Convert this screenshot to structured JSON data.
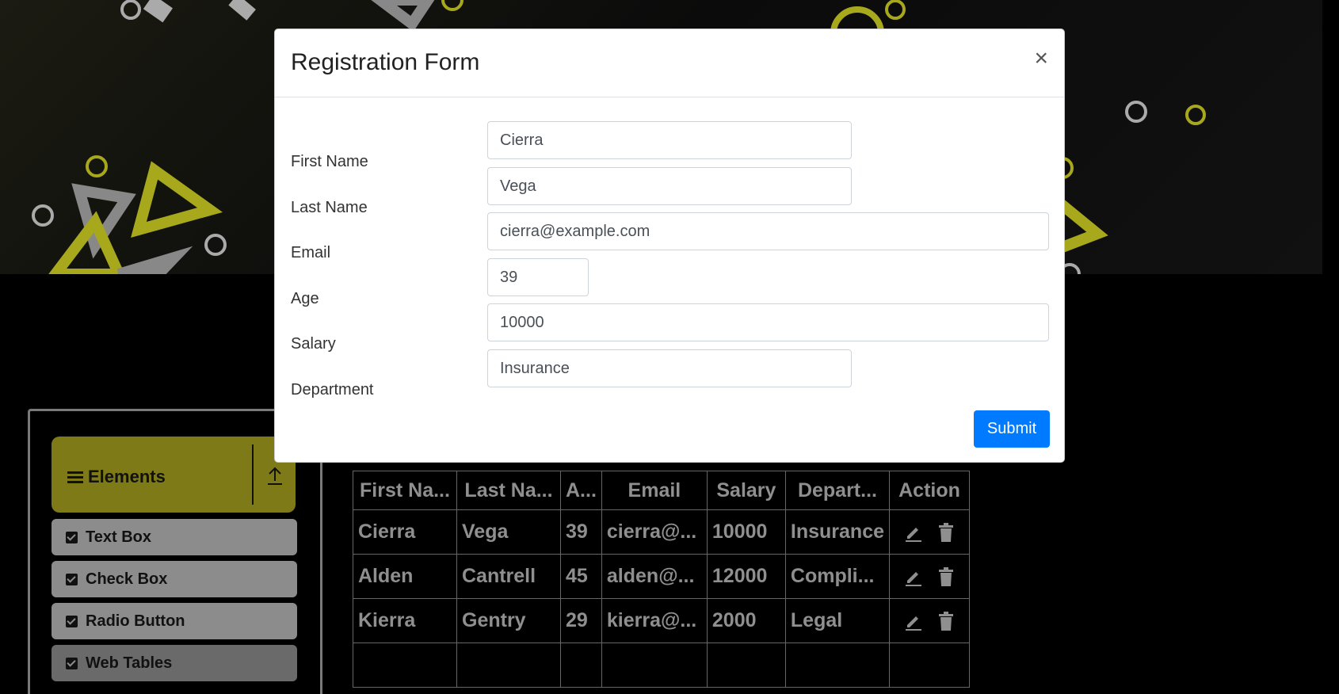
{
  "modal": {
    "title": "Registration Form",
    "close_label": "×",
    "fields": {
      "first_name": {
        "label": "First Name",
        "value": "Cierra"
      },
      "last_name": {
        "label": "Last Name",
        "value": "Vega"
      },
      "email": {
        "label": "Email",
        "value": "cierra@example.com"
      },
      "age": {
        "label": "Age",
        "value": "39"
      },
      "salary": {
        "label": "Salary",
        "value": "10000"
      },
      "department": {
        "label": "Department",
        "value": "Insurance"
      }
    },
    "submit_label": "Submit"
  },
  "sidebar": {
    "group_title": "Elements",
    "items": [
      {
        "label": "Text Box"
      },
      {
        "label": "Check Box"
      },
      {
        "label": "Radio Button"
      },
      {
        "label": "Web Tables"
      }
    ]
  },
  "table": {
    "headers": [
      "First Na...",
      "Last Na...",
      "A...",
      "Email",
      "Salary",
      "Depart...",
      "Action"
    ],
    "rows": [
      [
        "Cierra",
        "Vega",
        "39",
        "cierra@...",
        "10000",
        "Insurance"
      ],
      [
        "Alden",
        "Cantrell",
        "45",
        "alden@...",
        "12000",
        "Compli..."
      ],
      [
        "Kierra",
        "Gentry",
        "29",
        "kierra@...",
        "2000",
        "Legal"
      ]
    ]
  },
  "colors": {
    "accent": "#007bff",
    "group_header": "#7d7a17",
    "banner_yellow": "#a8a81c"
  }
}
